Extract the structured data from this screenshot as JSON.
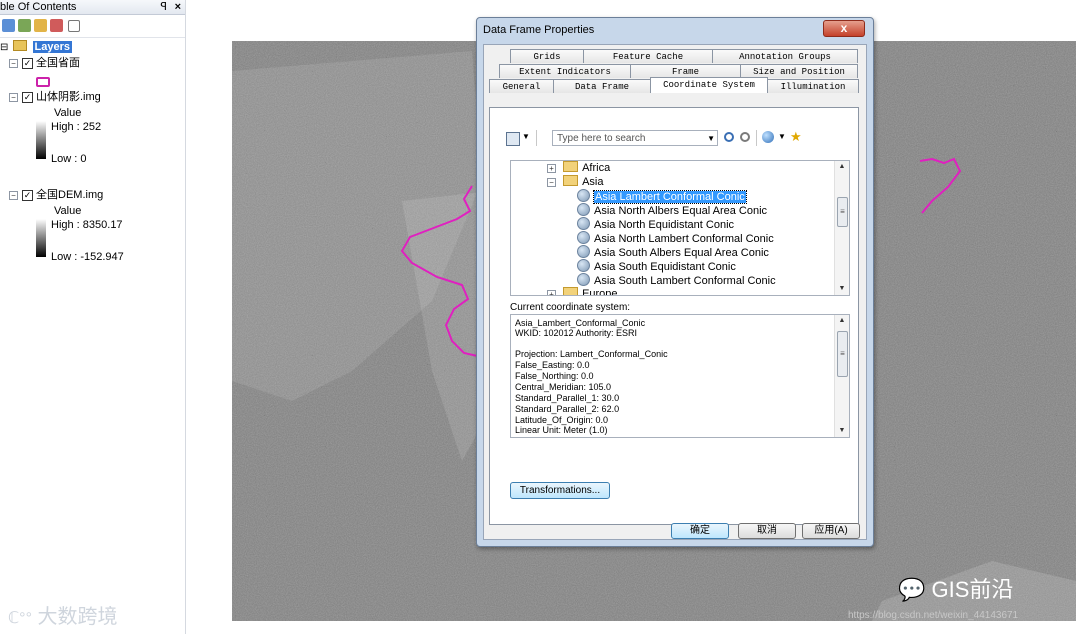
{
  "toc": {
    "title": "ble Of Contents",
    "pin": "ꟼ",
    "close": "×",
    "root_toggle": "⊟",
    "root_label": "Layers",
    "layers": [
      {
        "name": "全国省面",
        "checked": "☑",
        "toggle": "⊟"
      },
      {
        "name": "山体阴影.img",
        "checked": "☑",
        "toggle": "⊟",
        "value_label": "Value",
        "high": "High : 252",
        "low": "Low : 0"
      },
      {
        "name": "全国DEM.img",
        "checked": "☑",
        "toggle": "⊟",
        "value_label": "Value",
        "high": "High : 8350.17",
        "low": "Low : -152.947"
      }
    ],
    "province_symbol_color": "#cc22aa"
  },
  "map": {
    "boundary_color": "#e020c0",
    "watermark_left": "大数跨境",
    "watermark_right": "GIS前沿",
    "url_watermark": "https://blog.csdn.net/weixin_44143671"
  },
  "dialog": {
    "title": "Data Frame Properties",
    "close": "x",
    "tabs_row1": [
      "Grids",
      "Feature Cache",
      "Annotation Groups"
    ],
    "tabs_row2": [
      "Extent Indicators",
      "Frame",
      "Size and Position"
    ],
    "tabs_row3": [
      "General",
      "Data Frame",
      "Coordinate System",
      "Illumination"
    ],
    "active_tab": "Coordinate System",
    "search_placeholder": "Type here to search",
    "tree": {
      "africa": "Africa",
      "asia": "Asia",
      "europe": "Europe",
      "items": [
        "Asia Lambert Conformal Conic",
        "Asia North Albers Equal Area Conic",
        "Asia North Equidistant Conic",
        "Asia North Lambert Conformal Conic",
        "Asia South Albers Equal Area Conic",
        "Asia South Equidistant Conic",
        "Asia South Lambert Conformal Conic"
      ],
      "selected": "Asia Lambert Conformal Conic"
    },
    "current_label": "Current coordinate system:",
    "current_lines": [
      "Asia_Lambert_Conformal_Conic",
      "WKID: 102012 Authority: ESRI",
      "",
      "Projection: Lambert_Conformal_Conic",
      "False_Easting: 0.0",
      "False_Northing: 0.0",
      "Central_Meridian: 105.0",
      "Standard_Parallel_1: 30.0",
      "Standard_Parallel_2: 62.0",
      "Latitude_Of_Origin: 0.0",
      "Linear Unit: Meter (1.0)"
    ],
    "transformations": "Transformations...",
    "ok": "确定",
    "cancel": "取消",
    "apply": "应用(A)"
  }
}
